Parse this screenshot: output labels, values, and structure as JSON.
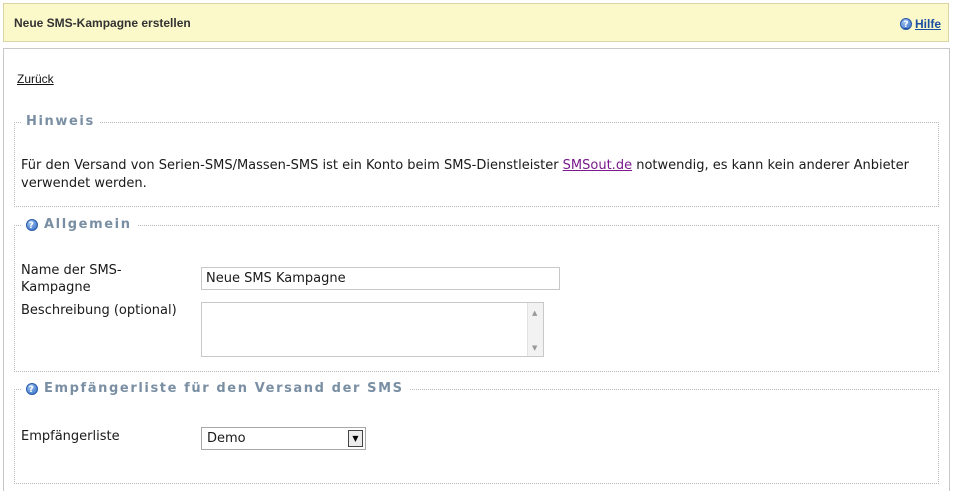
{
  "header": {
    "title": "Neue SMS-Kampagne erstellen",
    "help_label": "Hilfe"
  },
  "nav": {
    "back_label": "Zurück"
  },
  "hint_section": {
    "legend": "Hinweis",
    "text_before": "Für den Versand von Serien-SMS/Massen-SMS ist ein Konto beim SMS-Dienstleister ",
    "link_text": "SMSout.de",
    "text_after": " notwendig, es kann kein anderer Anbieter verwendet werden."
  },
  "general_section": {
    "legend": "Allgemein",
    "name_label": "Name der SMS-Kampagne",
    "name_value": "Neue SMS Kampagne",
    "description_label": "Beschreibung (optional)",
    "description_value": ""
  },
  "recipient_section": {
    "legend": "Empfängerliste für den Versand der SMS",
    "list_label": "Empfängerliste",
    "list_value": "Demo"
  },
  "icons": {
    "help": "question-circle-icon",
    "dropdown": "chevron-down-icon"
  }
}
